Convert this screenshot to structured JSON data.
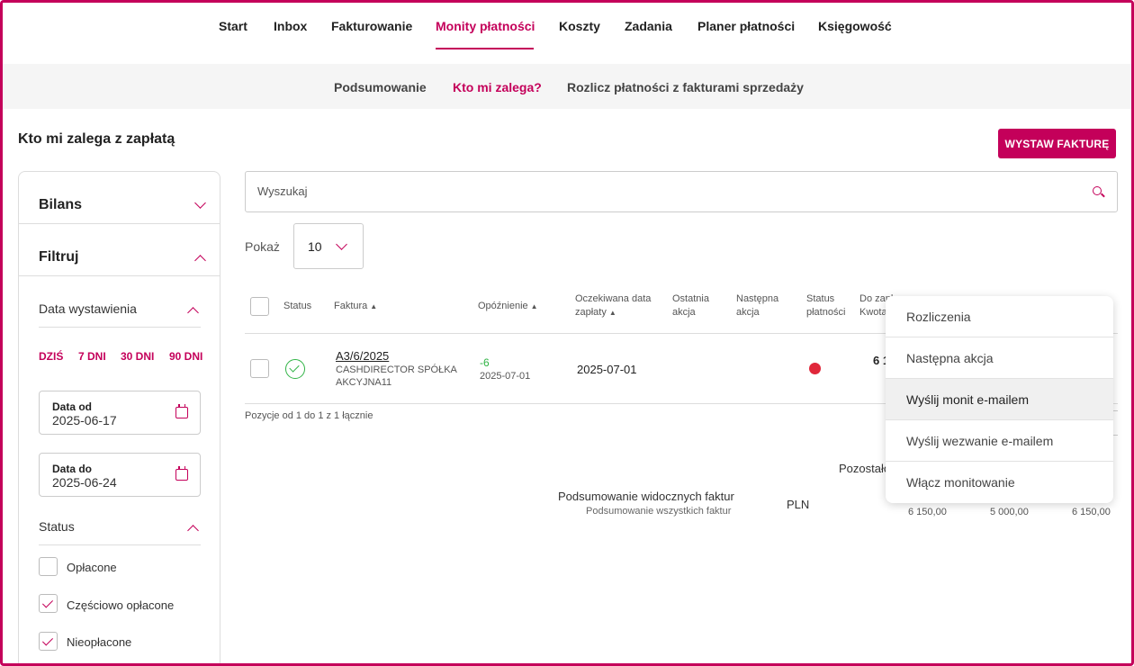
{
  "topnav": {
    "items": [
      "Start",
      "Inbox",
      "Fakturowanie",
      "Monity płatności",
      "Koszty",
      "Zadania",
      "Planer płatności",
      "Księgowość"
    ],
    "active": "Monity płatności"
  },
  "subnav": {
    "items": [
      "Podsumowanie",
      "Kto mi zalega?",
      "Rozlicz płatności z fakturami sprzedaży"
    ],
    "active": "Kto mi zalega?"
  },
  "page": {
    "title": "Kto mi zalega z zapłatą",
    "primary_button": "WYSTAW FAKTURĘ"
  },
  "sidebar": {
    "bilans": "Bilans",
    "filtruj": "Filtruj",
    "data_wystawienia": "Data wystawienia",
    "quick_ranges": [
      "DZIŚ",
      "7 DNI",
      "30 DNI",
      "90 DNI"
    ],
    "date_from": {
      "label": "Data od",
      "value": "2025-06-17"
    },
    "date_to": {
      "label": "Data do",
      "value": "2025-06-24"
    },
    "status_label": "Status",
    "status_options": [
      {
        "label": "Opłacone",
        "checked": false
      },
      {
        "label": "Częściowo opłacone",
        "checked": true
      },
      {
        "label": "Nieopłacone",
        "checked": true
      }
    ]
  },
  "search": {
    "placeholder": "Wyszukaj",
    "icon": "search-icon"
  },
  "show": {
    "label": "Pokaż",
    "value": "10"
  },
  "table": {
    "headers": {
      "status": "Status",
      "faktura": "Faktura",
      "opoznienie": "Opóźnienie",
      "oczekiwana_1": "Oczekiwana data",
      "oczekiwana_2": "zapłaty",
      "ostatnia_1": "Ostatnia",
      "ostatnia_2": "akcja",
      "nastepna_1": "Następna",
      "nastepna_2": "akcja",
      "status_pl_1": "Status",
      "status_pl_2": "płatności",
      "do_zap_1": "Do zapł",
      "do_zap_2": "Kwota"
    },
    "rows": [
      {
        "invoice_no": "A3/6/2025",
        "client_1": "CASHDIRECTOR SPÓŁKA",
        "client_2": "AKCYJNA11",
        "delay": "-6",
        "delay_date": "2025-07-01",
        "expected_date": "2025-07-01",
        "amount_partial": "6 1",
        "status_color": "#e0273a"
      }
    ],
    "footer": "Pozycje od 1 do 1 z 1 łącznie"
  },
  "summary": {
    "pozostalo": "Pozostało",
    "visible": "Podsumowanie widocznych faktur",
    "all": "Podsumowanie wszystkich faktur",
    "currency": "PLN",
    "values": [
      "6 150,00",
      "5 000,00",
      "6 150,00"
    ]
  },
  "menu": {
    "items": [
      "Rozliczenia",
      "Następna akcja",
      "Wyślij monit e-mailem",
      "Wyślij wezwanie e-mailem",
      "Włącz monitowanie"
    ],
    "hovered": "Wyślij monit e-mailem"
  },
  "colors": {
    "accent": "#c4005a",
    "ok": "#2fb344",
    "danger": "#e0273a"
  }
}
